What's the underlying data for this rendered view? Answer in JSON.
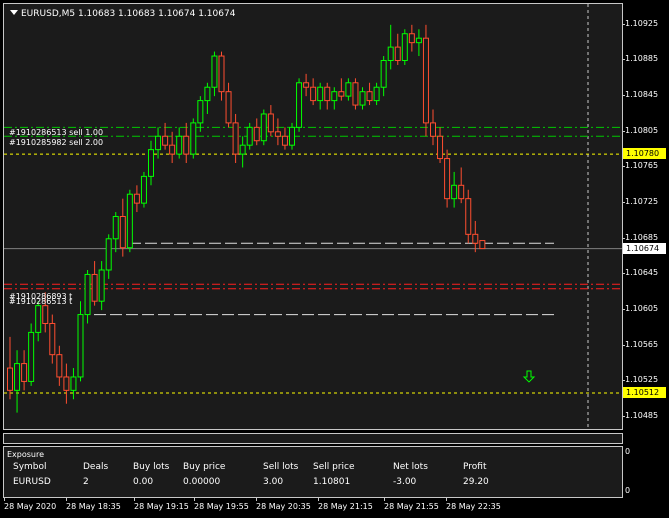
{
  "chart_data": {
    "type": "candlestick",
    "title": "EURUSD,M5 1.10683 1.10683 1.10674 1.10674",
    "symbol": "EURUSD",
    "timeframe": "M5",
    "ohlc_header": {
      "open": "1.10683",
      "high": "1.10683",
      "low": "1.10674",
      "close": "1.10674"
    },
    "y_ticks": [
      "1.10925",
      "1.10885",
      "1.10845",
      "1.10805",
      "1.10765",
      "1.10725",
      "1.10685",
      "1.10645",
      "1.10605",
      "1.10565",
      "1.10525",
      "1.10485"
    ],
    "ylim": [
      1.10475,
      1.10945
    ],
    "x_ticks": [
      "28 May 2020",
      "28 May 18:35",
      "28 May 19:15",
      "28 May 19:55",
      "28 May 20:35",
      "28 May 21:15",
      "28 May 21:55",
      "28 May 22:35"
    ],
    "price_tags": [
      {
        "value": "1.10780",
        "color": "#ffff00"
      },
      {
        "value": "1.10674",
        "color": "#ffffff"
      },
      {
        "value": "1.10512",
        "color": "#ffff00"
      }
    ],
    "order_labels": [
      {
        "text": "#1910286513 sell 1.00",
        "price": 1.1081
      },
      {
        "text": "#1910285982 sell 2.00",
        "price": 1.108
      },
      {
        "text": "#1910286893 t",
        "price": 1.10634
      },
      {
        "text": "#1910286513 t",
        "price": 1.10629
      }
    ],
    "up_color": "#00ff00",
    "down_color": "#ff4e30",
    "candles": [
      [
        1.1054,
        1.10575,
        1.10505,
        1.10515
      ],
      [
        1.10515,
        1.1056,
        1.1049,
        1.10545
      ],
      [
        1.10545,
        1.1056,
        1.10515,
        1.10525
      ],
      [
        1.10525,
        1.1059,
        1.1052,
        1.1058
      ],
      [
        1.1058,
        1.10615,
        1.1057,
        1.1061
      ],
      [
        1.1061,
        1.10625,
        1.1058,
        1.1059
      ],
      [
        1.1059,
        1.106,
        1.10545,
        1.10555
      ],
      [
        1.10555,
        1.10565,
        1.1052,
        1.1053
      ],
      [
        1.1053,
        1.10545,
        1.105,
        1.10515
      ],
      [
        1.10515,
        1.1054,
        1.10505,
        1.1053
      ],
      [
        1.1053,
        1.10615,
        1.10525,
        1.106
      ],
      [
        1.106,
        1.1065,
        1.1059,
        1.10645
      ],
      [
        1.10645,
        1.1066,
        1.1061,
        1.10615
      ],
      [
        1.10615,
        1.1066,
        1.10605,
        1.1065
      ],
      [
        1.1065,
        1.1069,
        1.1064,
        1.10685
      ],
      [
        1.10685,
        1.10715,
        1.1067,
        1.1071
      ],
      [
        1.1071,
        1.1073,
        1.10665,
        1.10675
      ],
      [
        1.10675,
        1.1074,
        1.1067,
        1.10735
      ],
      [
        1.10735,
        1.10745,
        1.10715,
        1.10725
      ],
      [
        1.10725,
        1.1076,
        1.1072,
        1.10755
      ],
      [
        1.10755,
        1.10795,
        1.10745,
        1.10785
      ],
      [
        1.10785,
        1.1081,
        1.10775,
        1.108
      ],
      [
        1.108,
        1.10815,
        1.10785,
        1.1079
      ],
      [
        1.1079,
        1.10805,
        1.1077,
        1.1078
      ],
      [
        1.1078,
        1.1081,
        1.10775,
        1.108
      ],
      [
        1.108,
        1.10815,
        1.1077,
        1.1078
      ],
      [
        1.1078,
        1.1082,
        1.10775,
        1.10815
      ],
      [
        1.10815,
        1.10845,
        1.10805,
        1.1084
      ],
      [
        1.1084,
        1.1086,
        1.10825,
        1.10855
      ],
      [
        1.10855,
        1.10895,
        1.10845,
        1.1089
      ],
      [
        1.1089,
        1.10895,
        1.1084,
        1.1085
      ],
      [
        1.1085,
        1.1086,
        1.1081,
        1.10815
      ],
      [
        1.10815,
        1.10825,
        1.1077,
        1.1078
      ],
      [
        1.1078,
        1.108,
        1.10765,
        1.1079
      ],
      [
        1.1079,
        1.10815,
        1.10785,
        1.1081
      ],
      [
        1.1081,
        1.1082,
        1.1079,
        1.10795
      ],
      [
        1.10795,
        1.1083,
        1.1079,
        1.10825
      ],
      [
        1.10825,
        1.10835,
        1.108,
        1.10805
      ],
      [
        1.10805,
        1.1082,
        1.1079,
        1.108
      ],
      [
        1.108,
        1.1081,
        1.10785,
        1.1079
      ],
      [
        1.1079,
        1.10815,
        1.10785,
        1.1081
      ],
      [
        1.1081,
        1.10865,
        1.10805,
        1.1086
      ],
      [
        1.1086,
        1.1087,
        1.10845,
        1.10855
      ],
      [
        1.10855,
        1.10865,
        1.10835,
        1.1084
      ],
      [
        1.1084,
        1.1086,
        1.1083,
        1.10855
      ],
      [
        1.10855,
        1.1086,
        1.1083,
        1.1084
      ],
      [
        1.1084,
        1.10855,
        1.1083,
        1.1085
      ],
      [
        1.1085,
        1.10865,
        1.1084,
        1.10845
      ],
      [
        1.10845,
        1.10865,
        1.1084,
        1.1086
      ],
      [
        1.1086,
        1.10865,
        1.1083,
        1.10835
      ],
      [
        1.10835,
        1.10855,
        1.1083,
        1.1085
      ],
      [
        1.1085,
        1.1086,
        1.10835,
        1.1084
      ],
      [
        1.1084,
        1.1086,
        1.10835,
        1.10855
      ],
      [
        1.10855,
        1.1089,
        1.10845,
        1.10885
      ],
      [
        1.10885,
        1.10925,
        1.10875,
        1.109
      ],
      [
        1.109,
        1.10915,
        1.1088,
        1.10885
      ],
      [
        1.10885,
        1.1092,
        1.1088,
        1.10915
      ],
      [
        1.10915,
        1.10925,
        1.10895,
        1.10905
      ],
      [
        1.10905,
        1.1092,
        1.1089,
        1.1091
      ],
      [
        1.1091,
        1.10925,
        1.108,
        1.10815
      ],
      [
        1.10815,
        1.1083,
        1.1079,
        1.108
      ],
      [
        1.108,
        1.1081,
        1.1077,
        1.10775
      ],
      [
        1.10775,
        1.10785,
        1.1072,
        1.1073
      ],
      [
        1.1073,
        1.1076,
        1.1072,
        1.10745
      ],
      [
        1.10745,
        1.10765,
        1.10725,
        1.1073
      ],
      [
        1.1073,
        1.1074,
        1.1068,
        1.1069
      ],
      [
        1.1069,
        1.10705,
        1.1067,
        1.1068
      ],
      [
        1.10683,
        1.10683,
        1.10674,
        1.10674
      ]
    ]
  },
  "exposure": {
    "title": "Exposure",
    "headers": [
      "Symbol",
      "Deals",
      "Buy lots",
      "Buy price",
      "Sell lots",
      "Sell price",
      "Net lots",
      "Profit"
    ],
    "row": [
      "EURUSD",
      "2",
      "0.00",
      "0.00000",
      "3.00",
      "1.10801",
      "-3.00",
      "29.20"
    ],
    "scale_top": "0",
    "scale_bottom": "0"
  }
}
